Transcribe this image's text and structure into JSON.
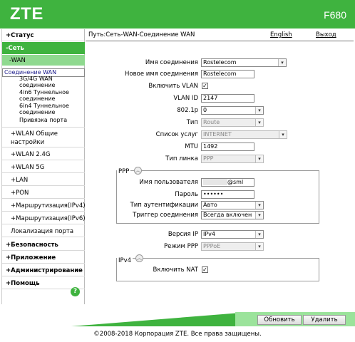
{
  "header": {
    "logo": "ZTE",
    "model": "F680"
  },
  "sidebar": {
    "status": "+Статус",
    "network": "-Сеть",
    "wan": "-WAN",
    "wan_items": [
      "Соединение WAN",
      "3G/4G WAN",
      "соединение",
      "4in6 Туннельное",
      "соединение",
      "6in4 Туннельное",
      "соединение",
      "Привязка порта"
    ],
    "wlan_common_1": "+WLAN Общие",
    "wlan_common_2": "настройки",
    "wlan24": "+WLAN 2.4G",
    "wlan5": "+WLAN 5G",
    "lan": "+LAN",
    "pon": "+PON",
    "routing4": "+Маршрутизация(IPv4)",
    "routing6": "+Маршрутизация(IPv6)",
    "port_loc": "Локализация порта",
    "security": "+Безопасность",
    "apps": "+Приложение",
    "admin": "+Администрирование",
    "help": "+Помощь",
    "help_icon": "?"
  },
  "breadcrumb": "Путь:Сеть-WAN-Соединение WAN",
  "lang_link": "English",
  "exit_link": "Выход",
  "form": {
    "conn_name_label": "Имя соединения",
    "conn_name_value": "Rostelecom",
    "new_conn_name_label": "Новое имя соединения",
    "new_conn_name_value": "Rostelecom",
    "vlan_enable_label": "Включить VLAN",
    "vlan_enable_checked": "✓",
    "vlan_id_label": "VLAN ID",
    "vlan_id_value": "2147",
    "p8021_label": "802.1p",
    "p8021_value": "0",
    "type_label": "Тип",
    "type_value": "Route",
    "services_label": "Список услуг",
    "services_value": "INTERNET",
    "mtu_label": "MTU",
    "mtu_value": "1492",
    "link_type_label": "Тип линка",
    "link_type_value": "PPP"
  },
  "ppp": {
    "legend": "PPP",
    "username_label": "Имя пользователя",
    "username_value": "@sml",
    "password_label": "Пароль",
    "password_value": "••••••",
    "auth_type_label": "Тип аутентификации",
    "auth_type_value": "Авто",
    "trigger_label": "Триггер соединения",
    "trigger_value": "Всегда включен"
  },
  "ip": {
    "ip_version_label": "Версия IP",
    "ip_version_value": "IPv4",
    "ppp_mode_label": "Режим PPP",
    "ppp_mode_value": "PPPoE"
  },
  "ipv4": {
    "legend": "IPv4",
    "nat_label": "Включить NAT",
    "nat_checked": "✓"
  },
  "buttons": {
    "update": "Обновить",
    "delete": "Удалить"
  },
  "footer": {
    "copyright": "©2008-2018 Корпорация ZTE. Все права защищены."
  },
  "colors": {
    "brand_green": "#3fb33f",
    "light_green": "#8fd98f"
  }
}
